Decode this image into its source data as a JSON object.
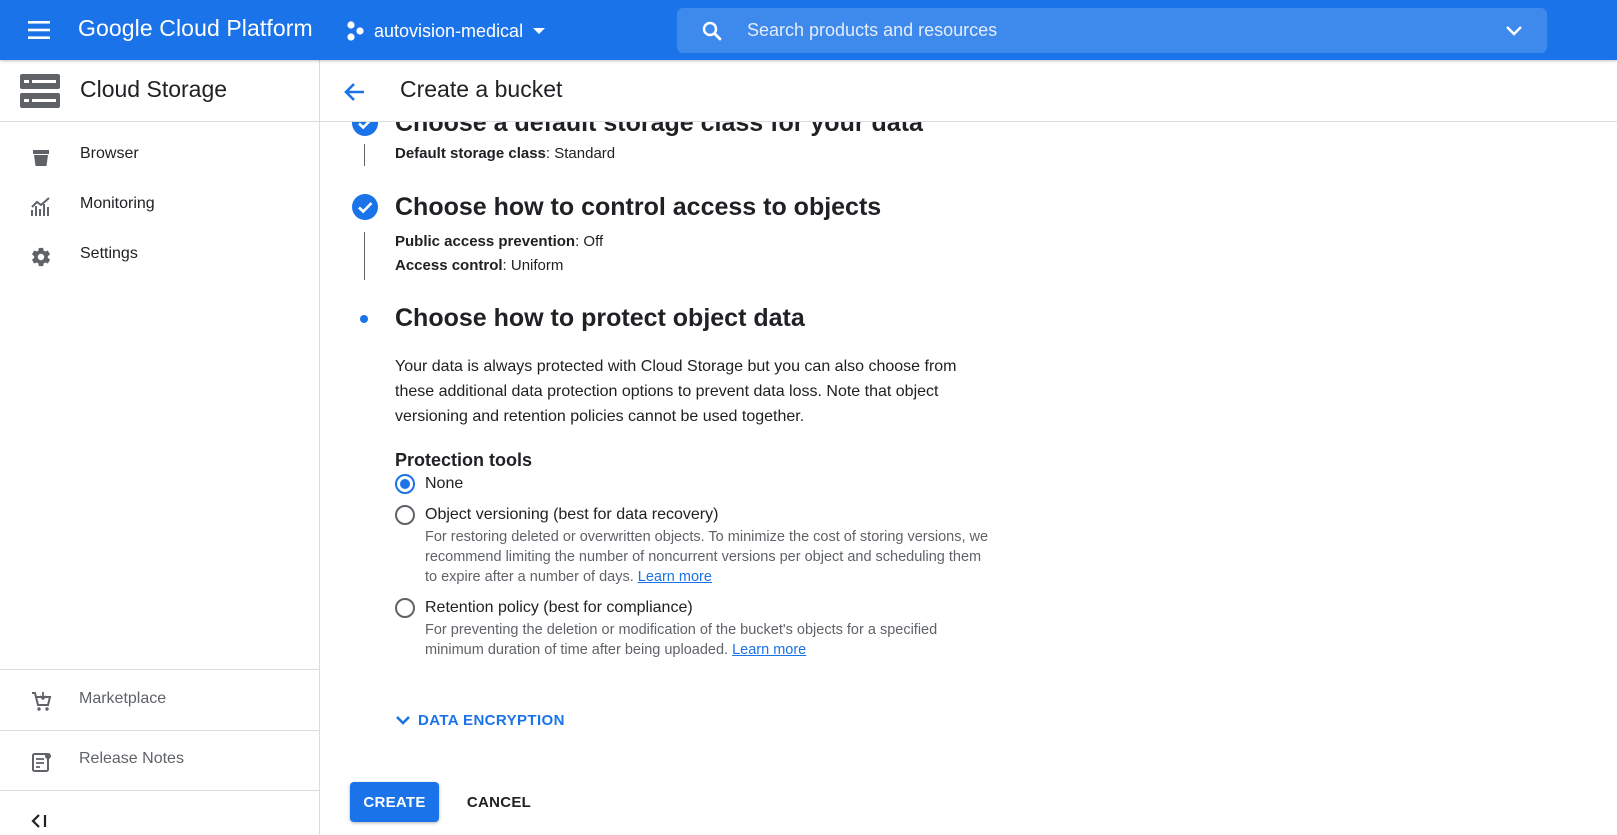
{
  "topbar": {
    "brand": "Google Cloud Platform",
    "project": "autovision-medical",
    "search_placeholder": "Search products and resources",
    "menu_icon": "hamburger-menu-icon",
    "search_icon": "search-icon"
  },
  "sidebar": {
    "title": "Cloud Storage",
    "items": [
      {
        "label": "Browser",
        "icon": "bucket-icon"
      },
      {
        "label": "Monitoring",
        "icon": "chart-icon"
      },
      {
        "label": "Settings",
        "icon": "gear-icon"
      }
    ],
    "bottom_items": [
      {
        "label": "Marketplace",
        "icon": "cart-icon"
      },
      {
        "label": "Release Notes",
        "icon": "notes-icon"
      }
    ]
  },
  "header": {
    "title": "Create a bucket"
  },
  "steps": {
    "storage_class": {
      "title": "Choose a default storage class for your data",
      "key": "Default storage class",
      "value": ": Standard"
    },
    "access": {
      "title": "Choose how to control access to objects",
      "pap_key": "Public access prevention",
      "pap_value": ": Off",
      "ac_key": "Access control",
      "ac_value": ": Uniform"
    },
    "protect": {
      "title": "Choose how to protect object data",
      "description": "Your data is always protected with Cloud Storage but you can also choose from these additional data protection options to prevent data loss. Note that object versioning and retention policies cannot be used together.",
      "tools_title": "Protection tools",
      "options": [
        {
          "label": "None",
          "checked": true
        },
        {
          "label": "Object versioning (best for data recovery)",
          "help": "For restoring deleted or overwritten objects. To minimize the cost of storing versions, we recommend limiting the number of noncurrent versions per object and scheduling them to expire after a number of days.",
          "link": "Learn more",
          "checked": false
        },
        {
          "label": "Retention policy (best for compliance)",
          "help": "For preventing the deletion or modification of the bucket's objects for a specified minimum duration of time after being uploaded.",
          "link": "Learn more",
          "checked": false
        }
      ],
      "expander": "DATA ENCRYPTION"
    }
  },
  "actions": {
    "create": "CREATE",
    "cancel": "CANCEL"
  },
  "colors": {
    "brand_blue": "#1a73e8",
    "text": "#202124",
    "secondary_text": "#5f6368",
    "divider": "#dadce0"
  }
}
